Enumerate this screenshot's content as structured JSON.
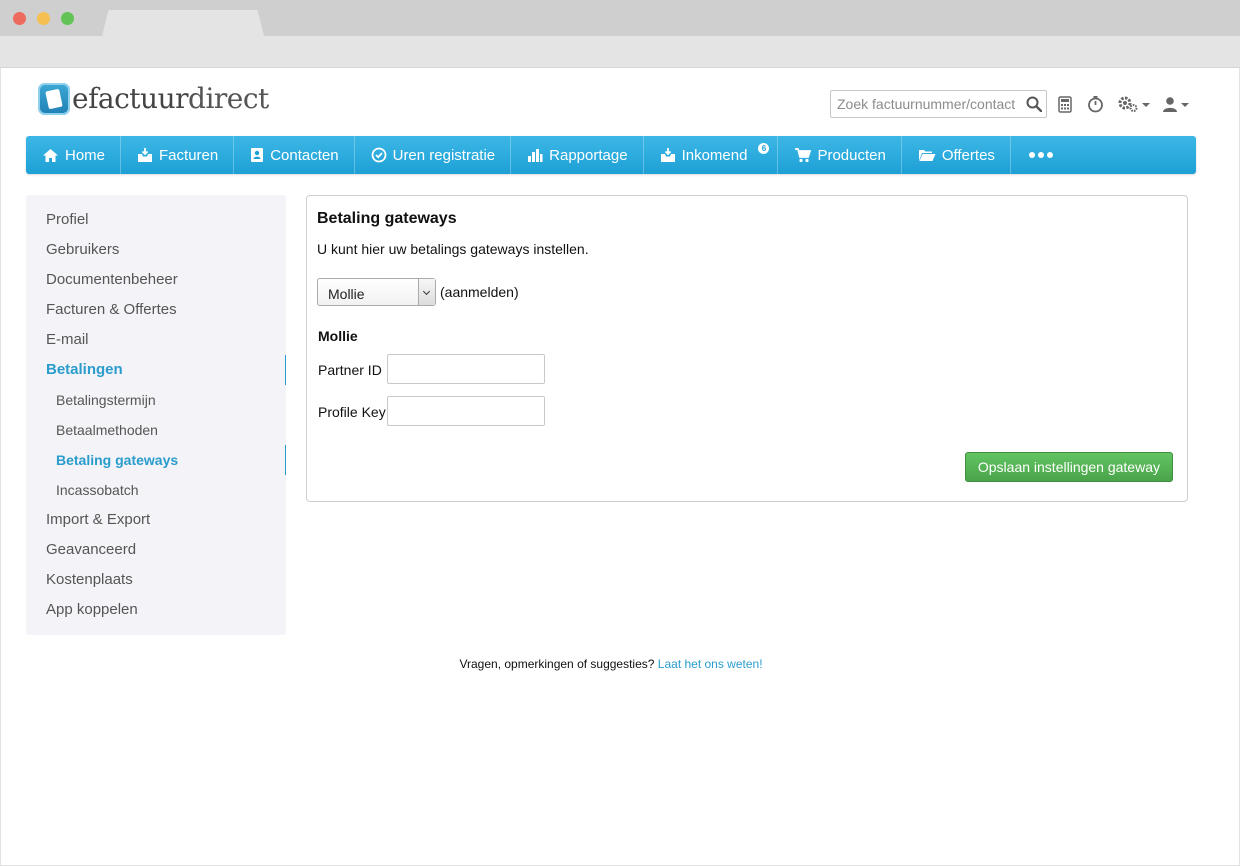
{
  "header": {
    "logo_prefix": "efactuur",
    "logo_suffix": "direct",
    "search_placeholder": "Zoek factuurnummer/contact"
  },
  "nav": {
    "items": [
      {
        "label": "Home",
        "icon": "home-icon"
      },
      {
        "label": "Facturen",
        "icon": "inbox-icon"
      },
      {
        "label": "Contacten",
        "icon": "contact-card-icon"
      },
      {
        "label": "Uren registratie",
        "icon": "clock-check-icon"
      },
      {
        "label": "Rapportage",
        "icon": "bar-chart-icon"
      },
      {
        "label": "Inkomend",
        "icon": "inbox-download-icon",
        "badge": "6"
      },
      {
        "label": "Producten",
        "icon": "cart-icon"
      },
      {
        "label": "Offertes",
        "icon": "folder-open-icon"
      }
    ],
    "more_icon": "more-dots-icon"
  },
  "sidebar": {
    "items": [
      {
        "label": "Profiel"
      },
      {
        "label": "Gebruikers"
      },
      {
        "label": "Documentenbeheer"
      },
      {
        "label": "Facturen & Offertes"
      },
      {
        "label": "E-mail"
      },
      {
        "label": "Betalingen"
      },
      {
        "label": "Betalingstermijn"
      },
      {
        "label": "Betaalmethoden"
      },
      {
        "label": "Betaling gateways"
      },
      {
        "label": "Incassobatch"
      },
      {
        "label": "Import & Export"
      },
      {
        "label": "Geavanceerd"
      },
      {
        "label": "Kostenplaats"
      },
      {
        "label": "App koppelen"
      }
    ]
  },
  "main": {
    "title": "Betaling gateways",
    "description": "U kunt hier uw betalings gateways instellen.",
    "gateway_select_value": "Mollie",
    "register_link": "(aanmelden)",
    "section_title": "Mollie",
    "partner_id_label": "Partner ID",
    "partner_id_value": "",
    "profile_key_label": "Profile Key",
    "profile_key_value": "",
    "save_button": "Opslaan instellingen gateway"
  },
  "footer": {
    "text": "Vragen, opmerkingen of suggesties?",
    "link": "Laat het ons weten!"
  },
  "colors": {
    "nav_blue": "#1ea0d5",
    "active_link": "#2a9ccd",
    "save_green": "#4aa44a"
  }
}
